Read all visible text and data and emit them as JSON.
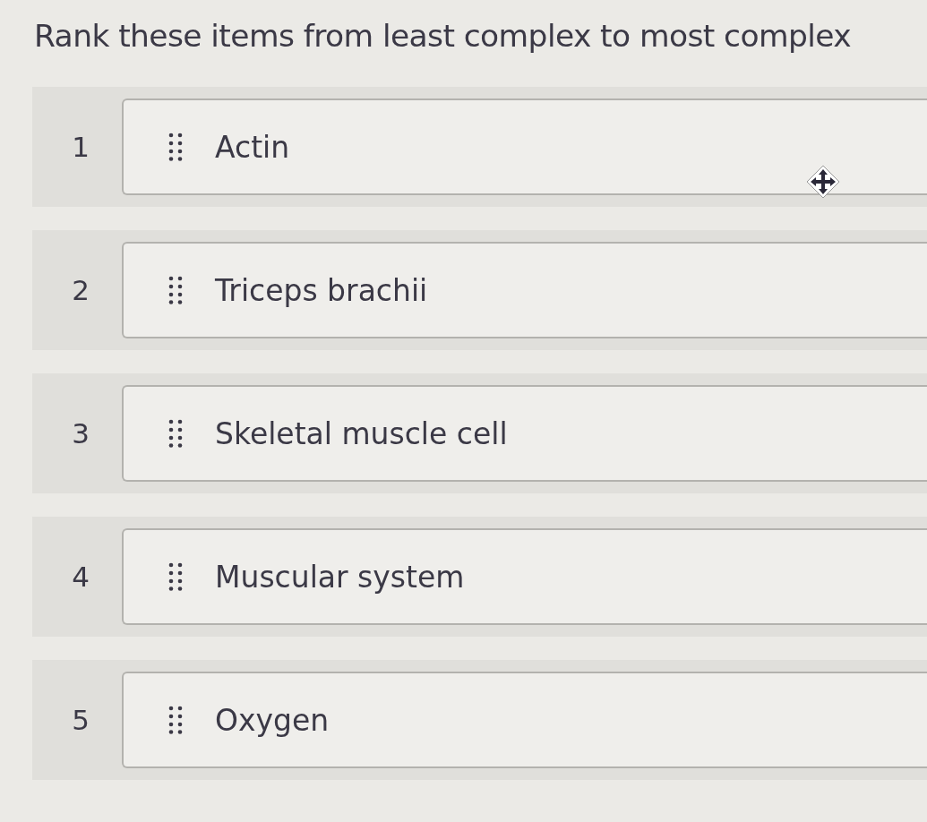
{
  "prompt": "Rank these items from least complex to most complex",
  "items": [
    {
      "rank": "1",
      "label": "Actin",
      "hovered": true
    },
    {
      "rank": "2",
      "label": "Triceps brachii",
      "hovered": false
    },
    {
      "rank": "3",
      "label": "Skeletal muscle cell",
      "hovered": false
    },
    {
      "rank": "4",
      "label": "Muscular system",
      "hovered": false
    },
    {
      "rank": "5",
      "label": "Oxygen",
      "hovered": false
    }
  ]
}
